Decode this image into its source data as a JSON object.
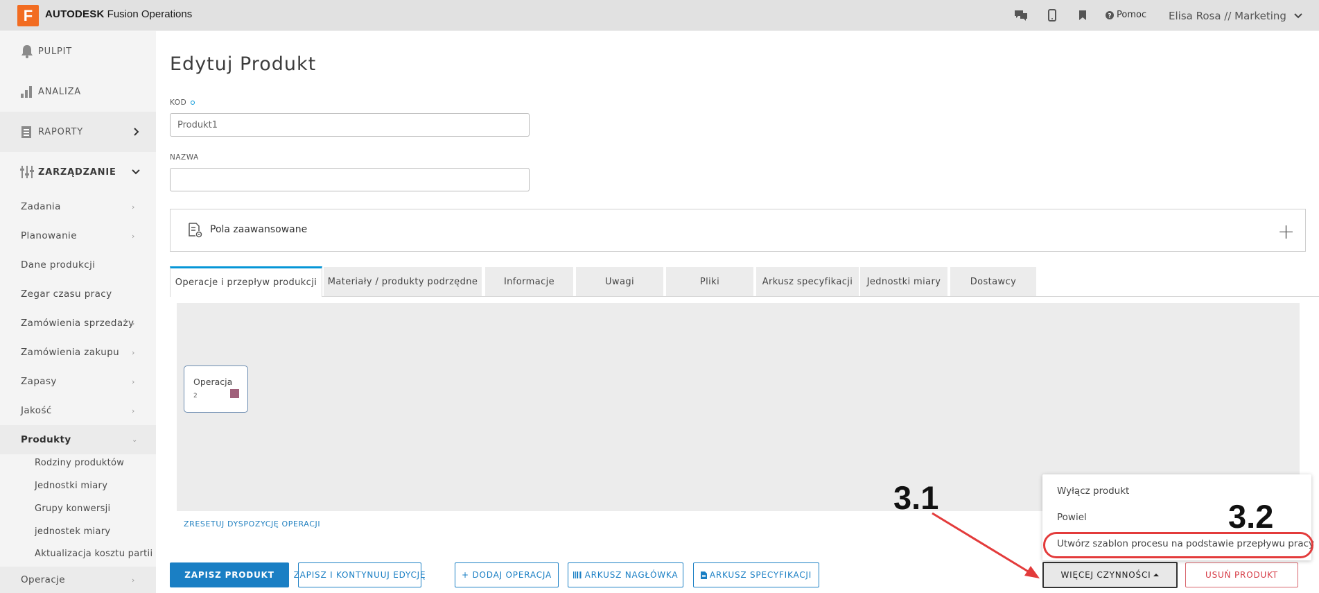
{
  "app": {
    "logo_letter": "F",
    "brand_strong": "AUTODESK",
    "brand_rest": "Fusion Operations",
    "help_label": "Pomoc",
    "user_label": "Elisa Rosa // Marketing"
  },
  "sidebar": {
    "top": [
      {
        "label": "PULPIT",
        "icon": "bell-icon"
      },
      {
        "label": "ANALIZA",
        "icon": "bar-chart-icon"
      },
      {
        "label": "RAPORTY",
        "icon": "report-icon"
      },
      {
        "label": "ZARZĄDZANIE",
        "icon": "sliders-icon"
      }
    ],
    "items": [
      {
        "label": "Zadania"
      },
      {
        "label": "Planowanie"
      },
      {
        "label": "Dane produkcji"
      },
      {
        "label": "Zegar czasu pracy"
      },
      {
        "label": "Zamówienia sprzedaży"
      },
      {
        "label": "Zamówienia zakupu"
      },
      {
        "label": "Zapasy"
      },
      {
        "label": "Jakość"
      },
      {
        "label": "Produkty"
      }
    ],
    "sub_items": [
      {
        "label": "Rodziny produktów"
      },
      {
        "label": "Jednostki miary"
      },
      {
        "label": "Grupy konwersji"
      },
      {
        "label": "jednostek miary"
      },
      {
        "label": "Aktualizacja kosztu partii"
      }
    ],
    "last_item": {
      "label": "Operacje"
    }
  },
  "main": {
    "title": "Edytuj Produkt",
    "kod_label": "KOD",
    "kod_value": "Produkt1",
    "nazwa_label": "NAZWA",
    "nazwa_value": "",
    "advanced_label": "Pola zaawansowane",
    "tabs": [
      {
        "label": "Operacje i przepływ produkcji"
      },
      {
        "label": "Materiały / produkty podrzędne"
      },
      {
        "label": "Informacje"
      },
      {
        "label": "Uwagi"
      },
      {
        "label": "Pliki"
      },
      {
        "label": "Arkusz specyfikacji"
      },
      {
        "label": "Jednostki miary"
      },
      {
        "label": "Dostawcy"
      }
    ],
    "operation_node": {
      "name": "Operacja",
      "number": "2",
      "color": "#a0607a"
    },
    "reset_label": "ZRESETUJ DYSPOZYCJĘ OPERACJI"
  },
  "buttons": {
    "save": "ZAPISZ PRODUKT",
    "save_continue": "ZAPISZ I KONTYNUUJ EDYCJĘ",
    "add_operation": "+ DODAJ OPERACJA",
    "header_sheet": "ARKUSZ NAGŁÓWKA",
    "spec_sheet": "ARKUSZ SPECYFIKACJI",
    "more_actions": "WIĘCEJ CZYNNOŚCI",
    "delete": "USUŃ PRODUKT"
  },
  "dropdown": {
    "items": [
      {
        "label": "Wyłącz produkt"
      },
      {
        "label": "Powiel"
      },
      {
        "label": "Utwórz szablon procesu na podstawie przepływu pracy"
      }
    ]
  },
  "annotations": {
    "step_a": "3.1",
    "step_b": "3.2",
    "color": "#e33b3b"
  },
  "colors": {
    "accent": "#1a7fc4",
    "brand": "#f26c21",
    "danger": "#d63a44"
  }
}
